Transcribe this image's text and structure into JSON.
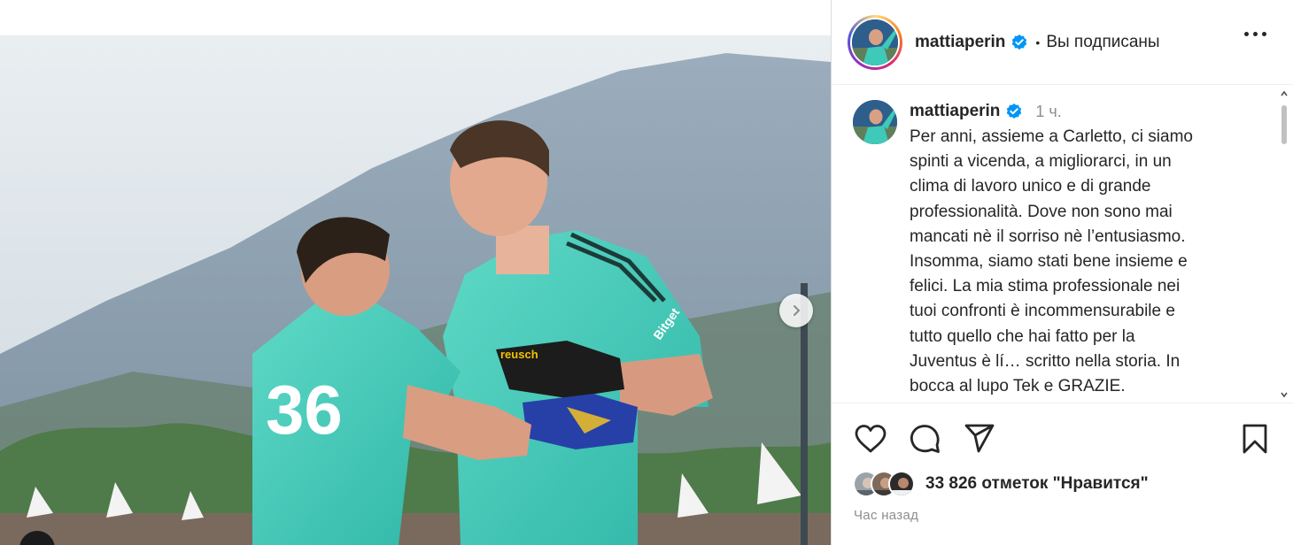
{
  "post": {
    "username": "mattiaperin",
    "follow_status": "Вы подписаны",
    "separator": "•",
    "caption_time": "1 ч.",
    "caption_text": "Per anni, assieme a Carletto, ci siamo\nspinti a vicenda, a migliorarci, in un\nclima di lavoro unico e di grande\nprofessionalità. Dove non sono mai\nmancati nè il sorriso nè l’entusiasmo.\nInsomma, siamo stati bene insieme e\nfelici. La mia stima professionale nei\ntuoi confronti è incommensurabile e\ntutto quello che hai fatto per la\nJuventus è lí… scritto nella storia. In\nbocca al lupo Tek e GRAZIE.",
    "likes_text": "33 826 отметок \"Нравится\"",
    "posted_ago": "Час назад"
  },
  "photo": {
    "jersey_number": "36",
    "sponsor_glove": "reusch",
    "sponsor_shirt": "Bitget"
  },
  "icons": {
    "like": "heart-icon",
    "comment": "comment-icon",
    "share": "share-icon",
    "save": "bookmark-icon",
    "more": "more-icon",
    "verified": "verified-icon",
    "next": "chevron-right-icon"
  },
  "colors": {
    "verified_blue": "#0095f6",
    "kit_teal": "#3ec9b8",
    "muted_text": "#8e8e8e"
  }
}
